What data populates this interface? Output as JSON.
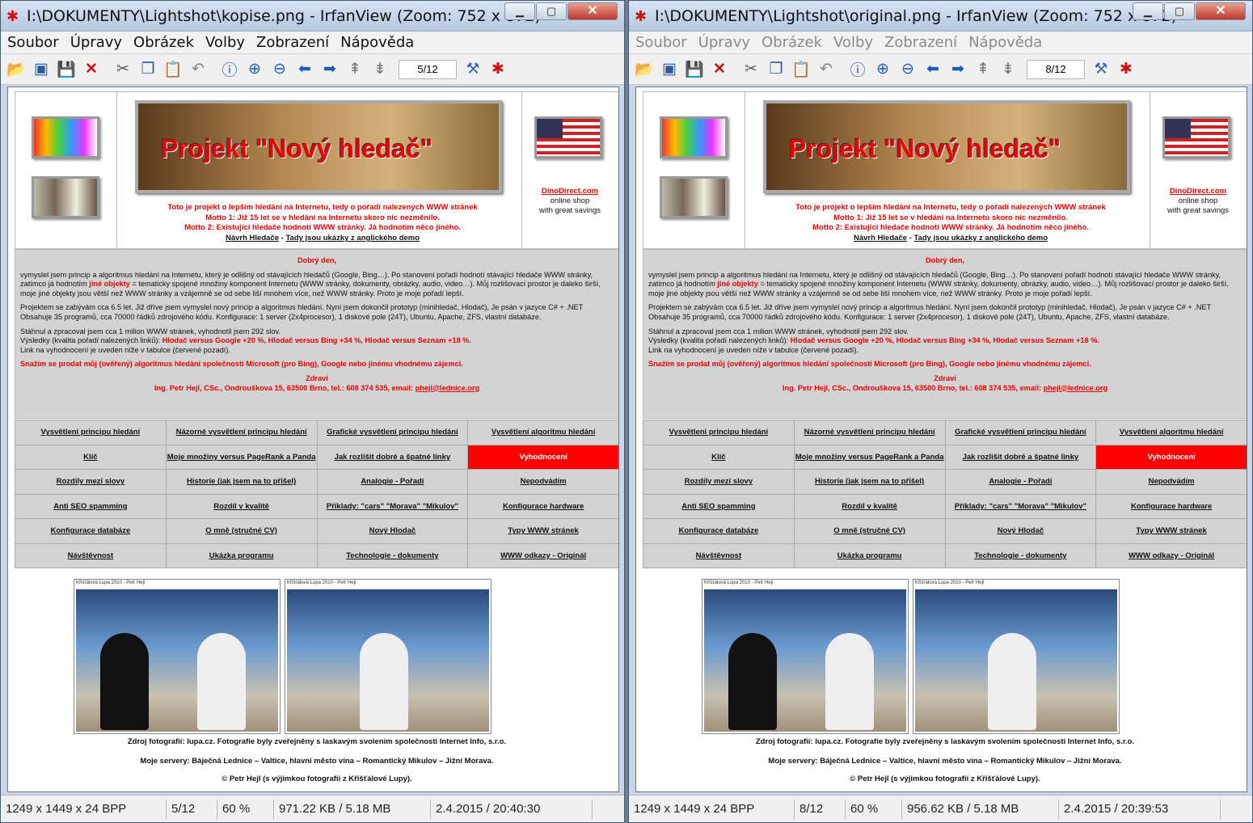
{
  "windows": [
    {
      "title": "I:\\DOKUMENTY\\Lightshot\\kopise.png - IrfanView (Zoom: 752 x 872)",
      "page_counter": "5/12",
      "status": {
        "dims": "1249 x 1449 x 24 BPP",
        "index": "5/12",
        "zoom": "60 %",
        "size": "971.22 KB / 5.18 MB",
        "date": "2.4.2015 / 20:40:30"
      }
    },
    {
      "title": "I:\\DOKUMENTY\\Lightshot\\original.png - IrfanView (Zoom: 752 x 872)",
      "page_counter": "8/12",
      "status": {
        "dims": "1249 x 1449 x 24 BPP",
        "index": "8/12",
        "zoom": "60 %",
        "size": "956.62 KB / 5.18 MB",
        "date": "2.4.2015 / 20:39:53"
      }
    }
  ],
  "menu": [
    "Soubor",
    "Úpravy",
    "Obrázek",
    "Volby",
    "Zobrazení",
    "Nápověda"
  ],
  "toolbar_icons": [
    "open-icon",
    "slideshow-icon",
    "save-icon",
    "delete-icon",
    "cut-icon",
    "copy-icon",
    "paste-icon",
    "undo-icon",
    "info-icon",
    "zoom-in-icon",
    "zoom-out-icon",
    "prev-icon",
    "next-icon",
    "first-page-icon",
    "last-page-icon",
    "settings-icon",
    "exit-icon"
  ],
  "web": {
    "banner": "Projekt \"Nový hledač\"",
    "intro1": "Toto je projekt o lepším hledání na Internetu, tedy o pořadí nalezených WWW stránek",
    "intro2": "Motto 1: Již 15 let se v hledání na Internetu skoro nic nezměnilo.",
    "intro3": "Motto 2: Existující hledače hodnotí WWW stránky. Já hodnotím něco jiného.",
    "intro_link1": "Návrh Hledače",
    "intro_sep": " - ",
    "intro_link2": "Tady jsou ukázky z anglického demo",
    "dino_link": "DinoDirect.com",
    "dino_l1": "online shop",
    "dino_l2": "with great savings",
    "greeting": "Dobrý den,",
    "p1a": "vymyslel jsem princip a algoritmus hledání na Internetu, který je odlišný od stávajících hledačů (Google, Bing…). Po stanovení pořadí hodnotí stávající hledače WWW stránky, zatímco já hodnotím ",
    "p1b": "jiné objekty",
    "p1c": " = tematicky spojené množiny komponent Internetu (WWW stránky, dokumenty, obrázky, audio, video…). Můj rozlišovací prostor je daleko širší, moje jiné objekty jsou větší než WWW stránky a vzájemně se od sebe liší mnohem více, než WWW stránky. Proto je moje pořadí lepší.",
    "p2": "Projektem se zabývám cca 6.5 let. Již dříve jsem vymyslel nový princip a algoritmus hledání. Nyní jsem dokončil prototyp (minihledač, Hlodač), Je psán v jazyce C# + .NET Obsahuje 35 programů, cca 70000 řádků zdrojového kódu. Konfigurace: 1 server (2x4procesor), 1 diskové pole (24T), Ubuntu, Apache, ZFS, vlastní databáze.",
    "p3a": "Stáhnul a zpracoval jsem cca 1 milion WWW stránek, vyhodnotil jsem 292 slov.",
    "p3b": "Výsledky (kvalita pořadí nalezených linků): ",
    "p3c": "Hlodač versus Google +20 %, Hlodač versus Bing +34 %, Hlodač versus Seznam +18 %.",
    "p3d": "Link na vyhodnocení je uveden níže v tabulce (červené pozadí).",
    "p4": "Snažím se prodat můj (ověřený) algoritmus hledání společnosti Microsoft (pro Bing), Google nebo jinému vhodnému zájemci.",
    "regards": "Zdraví",
    "signature_a": "Ing. Petr Hejl, CSc., Ondrouškova 15, 63500 Brno, tel.: 608 374 535, email: ",
    "signature_email": "phejl@lednice.org",
    "nav": [
      [
        "Vysvětlení principu hledání",
        "Názorné vysvětlení principu hledání",
        "Grafické vysvětlení principu hledání",
        "Vysvětlení algoritmu hledání"
      ],
      [
        "Klíč",
        "Moje množiny versus PageRank a Panda",
        "Jak rozlišit dobré a špatné linky",
        "Vyhodnocení"
      ],
      [
        "Rozdíly mezi slovy",
        "Historie (jak jsem na to přišel)",
        "Analogie - Pořadí",
        "Nepodvádím"
      ],
      [
        "Anti SEO spamming",
        "Rozdíl v kvalitě",
        "Příklady: \"cars\" \"Morava\" \"Mikulov\"",
        "Konfigurace hardware"
      ],
      [
        "Konfigurace databáze",
        "O mně (stručné CV)",
        "Nový Hlodač",
        "Typy WWW stránek"
      ],
      [
        "Návštěvnost",
        "Ukázka programu",
        "Technologie - dokumenty",
        "WWW odkazy - Originál"
      ]
    ],
    "photo_caption": "Křišťálová Lupa 2010 - Petr Hejl",
    "source": "Zdroj fotografií: lupa.cz. Fotografie byly zveřejněny s laskavým svolením společnosti Internet Info, s.r.o.",
    "servers": "Moje servery: Báječná Lednice – Valtice, hlavní město vína – Romantický Mikulov – Jižní Morava.",
    "copyright": "© Petr Hejl (s výjimkou fotografií z Křišťálové Lupy)."
  }
}
